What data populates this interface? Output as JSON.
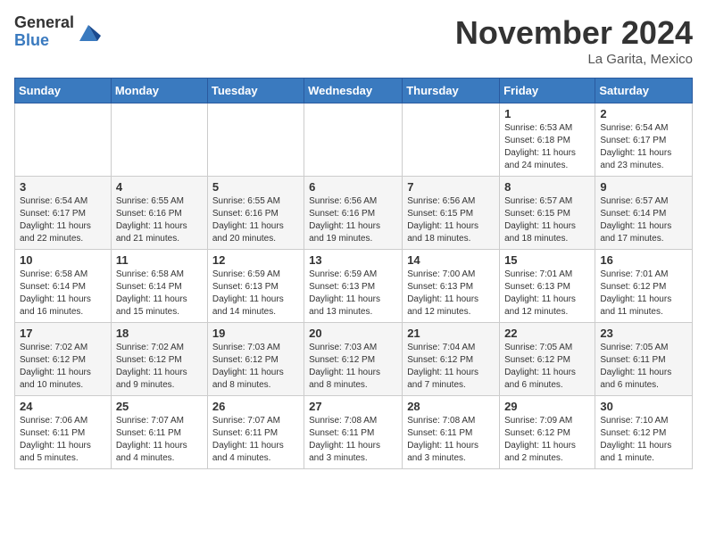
{
  "logo": {
    "general": "General",
    "blue": "Blue"
  },
  "title": "November 2024",
  "location": "La Garita, Mexico",
  "days_header": [
    "Sunday",
    "Monday",
    "Tuesday",
    "Wednesday",
    "Thursday",
    "Friday",
    "Saturday"
  ],
  "weeks": [
    [
      {
        "day": "",
        "info": ""
      },
      {
        "day": "",
        "info": ""
      },
      {
        "day": "",
        "info": ""
      },
      {
        "day": "",
        "info": ""
      },
      {
        "day": "",
        "info": ""
      },
      {
        "day": "1",
        "info": "Sunrise: 6:53 AM\nSunset: 6:18 PM\nDaylight: 11 hours and 24 minutes."
      },
      {
        "day": "2",
        "info": "Sunrise: 6:54 AM\nSunset: 6:17 PM\nDaylight: 11 hours and 23 minutes."
      }
    ],
    [
      {
        "day": "3",
        "info": "Sunrise: 6:54 AM\nSunset: 6:17 PM\nDaylight: 11 hours and 22 minutes."
      },
      {
        "day": "4",
        "info": "Sunrise: 6:55 AM\nSunset: 6:16 PM\nDaylight: 11 hours and 21 minutes."
      },
      {
        "day": "5",
        "info": "Sunrise: 6:55 AM\nSunset: 6:16 PM\nDaylight: 11 hours and 20 minutes."
      },
      {
        "day": "6",
        "info": "Sunrise: 6:56 AM\nSunset: 6:16 PM\nDaylight: 11 hours and 19 minutes."
      },
      {
        "day": "7",
        "info": "Sunrise: 6:56 AM\nSunset: 6:15 PM\nDaylight: 11 hours and 18 minutes."
      },
      {
        "day": "8",
        "info": "Sunrise: 6:57 AM\nSunset: 6:15 PM\nDaylight: 11 hours and 18 minutes."
      },
      {
        "day": "9",
        "info": "Sunrise: 6:57 AM\nSunset: 6:14 PM\nDaylight: 11 hours and 17 minutes."
      }
    ],
    [
      {
        "day": "10",
        "info": "Sunrise: 6:58 AM\nSunset: 6:14 PM\nDaylight: 11 hours and 16 minutes."
      },
      {
        "day": "11",
        "info": "Sunrise: 6:58 AM\nSunset: 6:14 PM\nDaylight: 11 hours and 15 minutes."
      },
      {
        "day": "12",
        "info": "Sunrise: 6:59 AM\nSunset: 6:13 PM\nDaylight: 11 hours and 14 minutes."
      },
      {
        "day": "13",
        "info": "Sunrise: 6:59 AM\nSunset: 6:13 PM\nDaylight: 11 hours and 13 minutes."
      },
      {
        "day": "14",
        "info": "Sunrise: 7:00 AM\nSunset: 6:13 PM\nDaylight: 11 hours and 12 minutes."
      },
      {
        "day": "15",
        "info": "Sunrise: 7:01 AM\nSunset: 6:13 PM\nDaylight: 11 hours and 12 minutes."
      },
      {
        "day": "16",
        "info": "Sunrise: 7:01 AM\nSunset: 6:12 PM\nDaylight: 11 hours and 11 minutes."
      }
    ],
    [
      {
        "day": "17",
        "info": "Sunrise: 7:02 AM\nSunset: 6:12 PM\nDaylight: 11 hours and 10 minutes."
      },
      {
        "day": "18",
        "info": "Sunrise: 7:02 AM\nSunset: 6:12 PM\nDaylight: 11 hours and 9 minutes."
      },
      {
        "day": "19",
        "info": "Sunrise: 7:03 AM\nSunset: 6:12 PM\nDaylight: 11 hours and 8 minutes."
      },
      {
        "day": "20",
        "info": "Sunrise: 7:03 AM\nSunset: 6:12 PM\nDaylight: 11 hours and 8 minutes."
      },
      {
        "day": "21",
        "info": "Sunrise: 7:04 AM\nSunset: 6:12 PM\nDaylight: 11 hours and 7 minutes."
      },
      {
        "day": "22",
        "info": "Sunrise: 7:05 AM\nSunset: 6:12 PM\nDaylight: 11 hours and 6 minutes."
      },
      {
        "day": "23",
        "info": "Sunrise: 7:05 AM\nSunset: 6:11 PM\nDaylight: 11 hours and 6 minutes."
      }
    ],
    [
      {
        "day": "24",
        "info": "Sunrise: 7:06 AM\nSunset: 6:11 PM\nDaylight: 11 hours and 5 minutes."
      },
      {
        "day": "25",
        "info": "Sunrise: 7:07 AM\nSunset: 6:11 PM\nDaylight: 11 hours and 4 minutes."
      },
      {
        "day": "26",
        "info": "Sunrise: 7:07 AM\nSunset: 6:11 PM\nDaylight: 11 hours and 4 minutes."
      },
      {
        "day": "27",
        "info": "Sunrise: 7:08 AM\nSunset: 6:11 PM\nDaylight: 11 hours and 3 minutes."
      },
      {
        "day": "28",
        "info": "Sunrise: 7:08 AM\nSunset: 6:11 PM\nDaylight: 11 hours and 3 minutes."
      },
      {
        "day": "29",
        "info": "Sunrise: 7:09 AM\nSunset: 6:12 PM\nDaylight: 11 hours and 2 minutes."
      },
      {
        "day": "30",
        "info": "Sunrise: 7:10 AM\nSunset: 6:12 PM\nDaylight: 11 hours and 1 minute."
      }
    ]
  ]
}
